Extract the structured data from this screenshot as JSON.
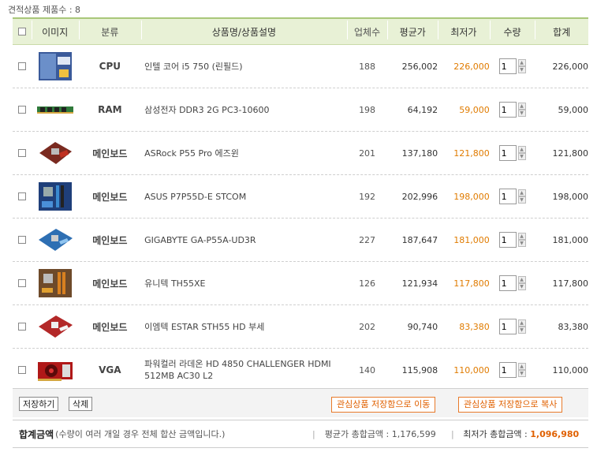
{
  "summary": {
    "count_label": "견적상품 제품수 : 8"
  },
  "header": {
    "image": "이미지",
    "category": "분류",
    "name": "상품명/상품설명",
    "vendors": "업체수",
    "avg": "평균가",
    "min": "최저가",
    "qty": "수량",
    "sum": "합계"
  },
  "rows": [
    {
      "category": "CPU",
      "name": "인텔 코어 i5 750 (린필드)",
      "vendors": "188",
      "avg": "256,002",
      "min": "226,000",
      "qty": "1",
      "sum": "226,000",
      "thumb": "cpu-box"
    },
    {
      "category": "RAM",
      "name": "삼성전자 DDR3 2G PC3-10600",
      "vendors": "198",
      "avg": "64,192",
      "min": "59,000",
      "qty": "1",
      "sum": "59,000",
      "thumb": "ram"
    },
    {
      "category": "메인보드",
      "name": "ASRock P55 Pro 에즈윈",
      "vendors": "201",
      "avg": "137,180",
      "min": "121,800",
      "qty": "1",
      "sum": "121,800",
      "thumb": "board-red"
    },
    {
      "category": "메인보드",
      "name": "ASUS P7P55D-E STCOM",
      "vendors": "192",
      "avg": "202,996",
      "min": "198,000",
      "qty": "1",
      "sum": "198,000",
      "thumb": "board-blue"
    },
    {
      "category": "메인보드",
      "name": "GIGABYTE GA-P55A-UD3R",
      "vendors": "227",
      "avg": "187,647",
      "min": "181,000",
      "qty": "1",
      "sum": "181,000",
      "thumb": "board-lightblue"
    },
    {
      "category": "메인보드",
      "name": "유니텍 TH55XE",
      "vendors": "126",
      "avg": "121,934",
      "min": "117,800",
      "qty": "1",
      "sum": "117,800",
      "thumb": "board-brown"
    },
    {
      "category": "메인보드",
      "name": "이엠텍 ESTAR STH55 HD 부세",
      "vendors": "202",
      "avg": "90,740",
      "min": "83,380",
      "qty": "1",
      "sum": "83,380",
      "thumb": "board-redwhite"
    },
    {
      "category": "VGA",
      "name": "파워컬러 라데온 HD 4850 CHALLENGER HDMI 512MB AC30 L2",
      "vendors": "140",
      "avg": "115,908",
      "min": "110,000",
      "qty": "1",
      "sum": "110,000",
      "thumb": "gpu-red"
    }
  ],
  "actions": {
    "save": "저장하기",
    "delete": "삭제",
    "move": "관심상품 저장함으로 이동",
    "copy": "관심상품 저장함으로 복사"
  },
  "totals": {
    "label": "합계금액",
    "note": "(수량이 여러 개일 경우 전체 합산 금액입니다.)",
    "avg_label": "평균가 총합금액 : 1,176,599",
    "min_label": "최저가 총합금액 : ",
    "min_value": "1,096,980"
  },
  "colors": {
    "accent": "#e06000",
    "header_bg": "#e8f1d6",
    "header_border": "#a9c77a"
  }
}
